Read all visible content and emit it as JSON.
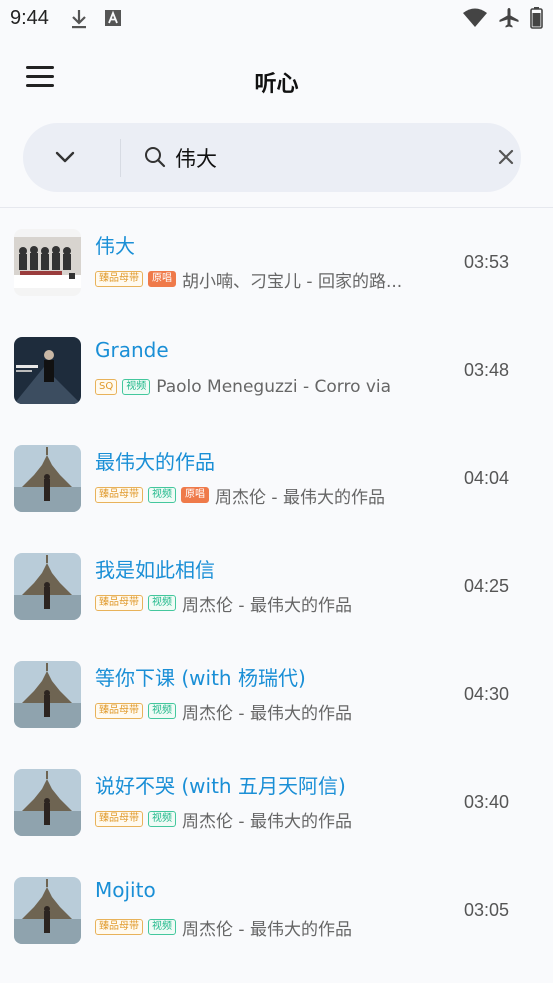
{
  "status": {
    "time": "9:44"
  },
  "header": {
    "title": "听心"
  },
  "search": {
    "value": "伟大"
  },
  "songs": [
    {
      "title": "伟大",
      "tags": [
        {
          "text": "臻品母带",
          "style": "gold"
        },
        {
          "text": "原唱",
          "style": "orange"
        }
      ],
      "artist": "胡小喃、刁宝儿 - 回家的路...",
      "duration": "03:53",
      "cover": "cover-group"
    },
    {
      "title": "Grande",
      "tags": [
        {
          "text": "SQ",
          "style": "gold"
        },
        {
          "text": "视频",
          "style": "green"
        }
      ],
      "artist": "Paolo Meneguzzi - Corro via",
      "duration": "03:48",
      "cover": "cover-dark"
    },
    {
      "title": "最伟大的作品",
      "tags": [
        {
          "text": "臻品母带",
          "style": "gold"
        },
        {
          "text": "视频",
          "style": "green"
        },
        {
          "text": "原唱",
          "style": "orange"
        }
      ],
      "artist": "周杰伦 - 最伟大的作品",
      "duration": "04:04",
      "cover": "cover-castle"
    },
    {
      "title": "我是如此相信",
      "tags": [
        {
          "text": "臻品母带",
          "style": "gold"
        },
        {
          "text": "视频",
          "style": "green"
        }
      ],
      "artist": "周杰伦 - 最伟大的作品",
      "duration": "04:25",
      "cover": "cover-castle"
    },
    {
      "title": "等你下课 (with 杨瑞代)",
      "tags": [
        {
          "text": "臻品母带",
          "style": "gold"
        },
        {
          "text": "视频",
          "style": "green"
        }
      ],
      "artist": "周杰伦 - 最伟大的作品",
      "duration": "04:30",
      "cover": "cover-castle"
    },
    {
      "title": "说好不哭 (with 五月天阿信)",
      "tags": [
        {
          "text": "臻品母带",
          "style": "gold"
        },
        {
          "text": "视频",
          "style": "green"
        }
      ],
      "artist": "周杰伦 - 最伟大的作品",
      "duration": "03:40",
      "cover": "cover-castle"
    },
    {
      "title": "Mojito",
      "tags": [
        {
          "text": "臻品母带",
          "style": "gold"
        },
        {
          "text": "视频",
          "style": "green"
        }
      ],
      "artist": "周杰伦 - 最伟大的作品",
      "duration": "03:05",
      "cover": "cover-castle"
    }
  ]
}
